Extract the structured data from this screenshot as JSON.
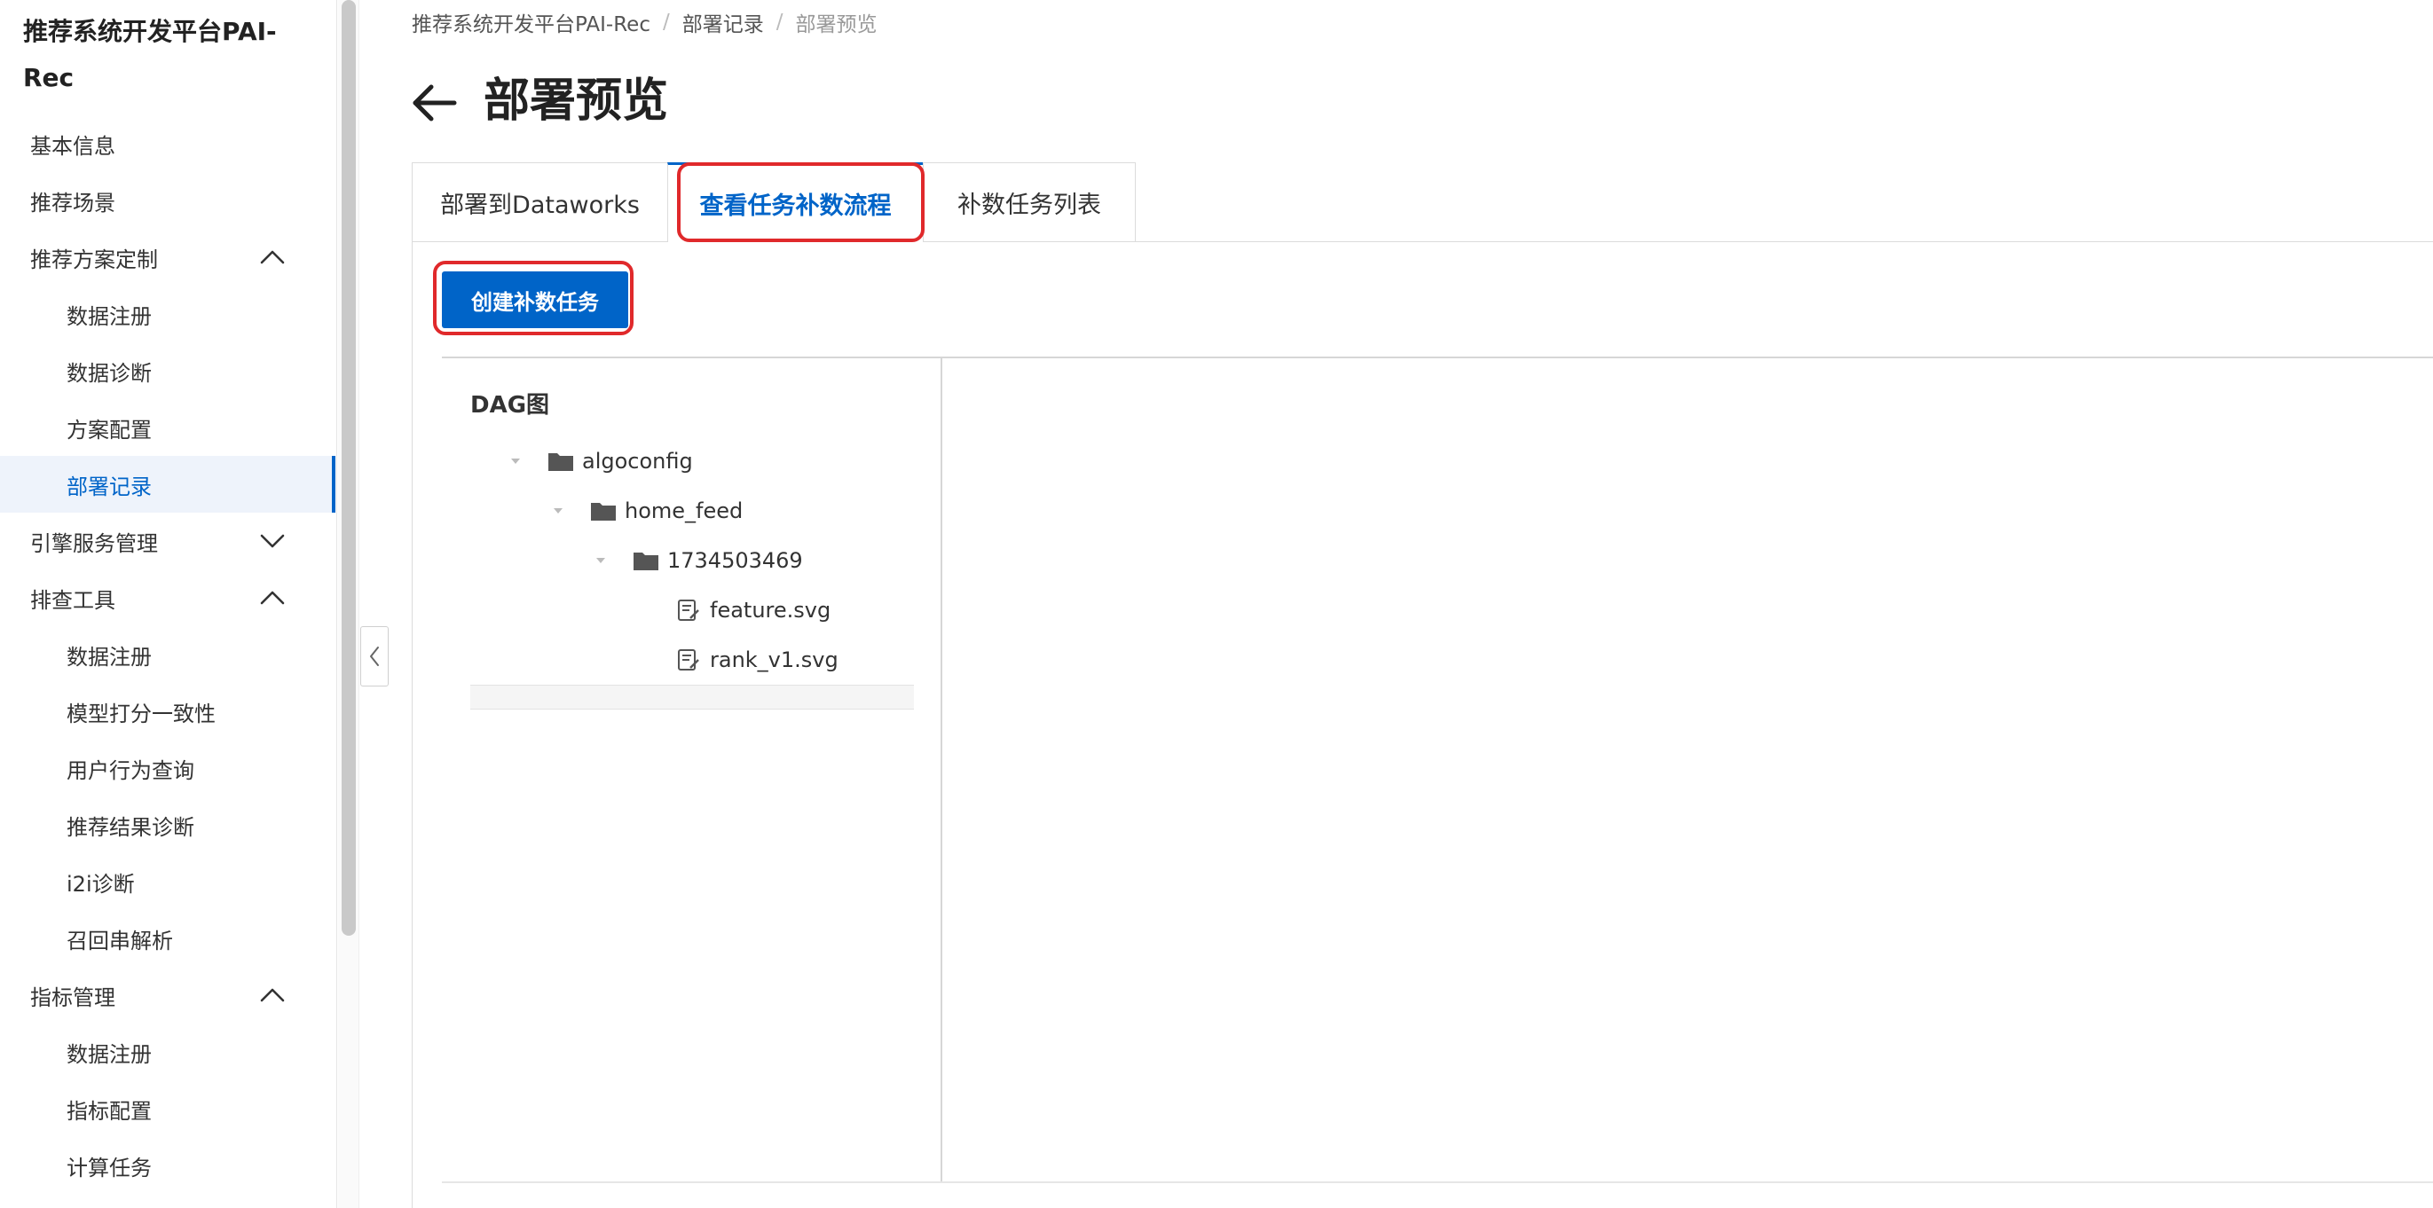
{
  "sidebar": {
    "brand": "推荐系统开发平台PAI-Rec",
    "items": [
      {
        "label": "基本信息",
        "level": 1
      },
      {
        "label": "推荐场景",
        "level": 1
      },
      {
        "label": "推荐方案定制",
        "level": 1,
        "chevron": "up"
      },
      {
        "label": "数据注册",
        "level": 2
      },
      {
        "label": "数据诊断",
        "level": 2
      },
      {
        "label": "方案配置",
        "level": 2
      },
      {
        "label": "部署记录",
        "level": 2,
        "active": true
      },
      {
        "label": "引擎服务管理",
        "level": 1,
        "chevron": "down"
      },
      {
        "label": "排查工具",
        "level": 1,
        "chevron": "up"
      },
      {
        "label": "数据注册",
        "level": 2
      },
      {
        "label": "模型打分一致性",
        "level": 2
      },
      {
        "label": "用户行为查询",
        "level": 2
      },
      {
        "label": "推荐结果诊断",
        "level": 2
      },
      {
        "label": "i2i诊断",
        "level": 2
      },
      {
        "label": "召回串解析",
        "level": 2
      },
      {
        "label": "指标管理",
        "level": 1,
        "chevron": "up"
      },
      {
        "label": "数据注册",
        "level": 2
      },
      {
        "label": "指标配置",
        "level": 2
      },
      {
        "label": "计算任务",
        "level": 2
      }
    ]
  },
  "breadcrumb": {
    "items": [
      "推荐系统开发平台PAI-Rec",
      "部署记录",
      "部署预览"
    ],
    "separator": "/"
  },
  "header": {
    "title": "部署预览",
    "back_icon": "arrow-left-icon"
  },
  "tabs": [
    {
      "label": "部署到Dataworks"
    },
    {
      "label": "查看任务补数流程",
      "active": true
    },
    {
      "label": "补数任务列表"
    }
  ],
  "toolbar": {
    "create_label": "创建补数任务"
  },
  "dag": {
    "label": "DAG图",
    "tree": [
      {
        "label": "algoconfig",
        "type": "folder",
        "depth": 0,
        "expanded": true
      },
      {
        "label": "home_feed",
        "type": "folder",
        "depth": 1,
        "expanded": true
      },
      {
        "label": "1734503469",
        "type": "folder",
        "depth": 2,
        "expanded": true
      },
      {
        "label": "feature.svg",
        "type": "file",
        "depth": 3
      },
      {
        "label": "rank_v1.svg",
        "type": "file",
        "depth": 3
      }
    ]
  },
  "colors": {
    "primary": "#0064c8",
    "highlight": "#e0292b",
    "active_bg": "#eef3fb"
  }
}
